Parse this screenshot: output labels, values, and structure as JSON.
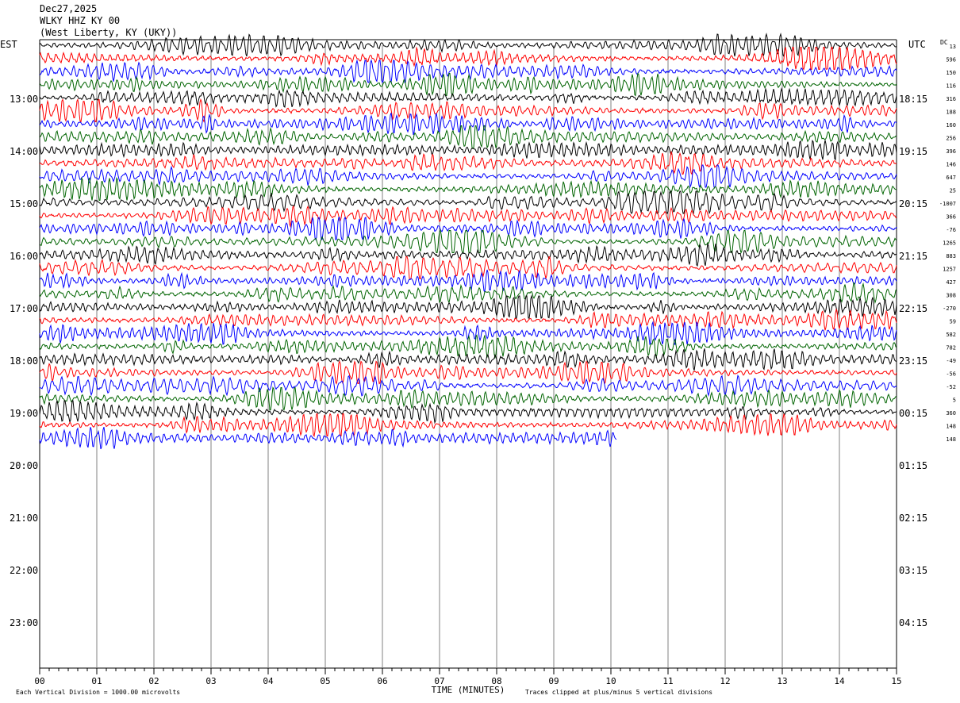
{
  "header": {
    "date": "Dec27,2025",
    "station": "WLKY HHZ KY 00",
    "location": "(West Liberty, KY (UKY))"
  },
  "left_timezone": "EST",
  "right_timezone": "UTC",
  "dc_header": "DC",
  "footer": {
    "division_note": "Each Vertical Division = 1000.00 microvolts",
    "xlabel": "TIME (MINUTES)",
    "clip_note": "Traces clipped at plus/minus 5 vertical divisions"
  },
  "colors": {
    "trace_cycle": [
      "#000000",
      "#ff0000",
      "#0000ff",
      "#006400"
    ],
    "grid": "#808080"
  },
  "chart_data": {
    "type": "line",
    "title": "",
    "xlabel": "TIME (MINUTES)",
    "xlim": [
      0,
      15
    ],
    "x_ticks": [
      "00",
      "01",
      "02",
      "03",
      "04",
      "05",
      "06",
      "07",
      "08",
      "09",
      "10",
      "11",
      "12",
      "13",
      "14",
      "15"
    ],
    "left_hour_labels": [
      "13:00",
      "14:00",
      "15:00",
      "16:00",
      "17:00",
      "18:00",
      "19:00",
      "20:00",
      "21:00",
      "22:00",
      "23:00"
    ],
    "right_hour_labels": [
      "18:15",
      "19:15",
      "20:15",
      "21:15",
      "22:15",
      "23:15",
      "00:15",
      "01:15",
      "02:15",
      "03:15",
      "04:15"
    ],
    "rows_per_hour": 4,
    "dc_offsets": [
      "13",
      "596",
      "150",
      "116",
      "316",
      "188",
      "160",
      "256",
      "396",
      "146",
      "647",
      "25",
      "-1007",
      "366",
      "-76",
      "1265",
      "883",
      "1257",
      "427",
      "308",
      "-270",
      "59",
      "582",
      "782",
      "-49",
      "-56",
      "-52",
      "5",
      "360",
      "148",
      "148"
    ],
    "trace_count": 31,
    "last_trace_end_minute": 10.1,
    "division_microvolts": 1000.0,
    "clip_divisions": 5
  }
}
